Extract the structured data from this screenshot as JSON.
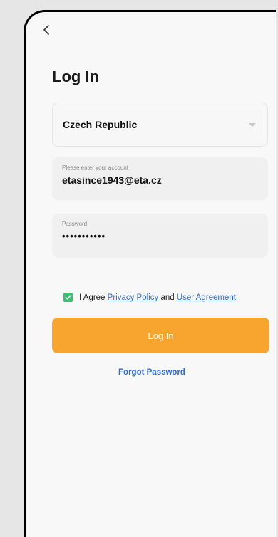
{
  "page": {
    "title": "Log In"
  },
  "country": {
    "value": "Czech Republic"
  },
  "account": {
    "label": "Please enter your account",
    "value": "etasince1943@eta.cz"
  },
  "password": {
    "label": "Password",
    "value": "•••••••••••"
  },
  "agreement": {
    "checked": true,
    "prefix": "I Agree",
    "privacy_link": "Privacy Policy",
    "and": "and",
    "user_link": "User Agreement"
  },
  "login_button": {
    "label": "Log In"
  },
  "forgot_link": {
    "label": "Forgot Password"
  },
  "colors": {
    "accent": "#f7a52e",
    "link": "#2f6bd8",
    "checkbox": "#35c46e"
  },
  "icons": {
    "back": "chevron-left-icon",
    "dropdown": "caret-down-icon",
    "check": "check-icon"
  }
}
